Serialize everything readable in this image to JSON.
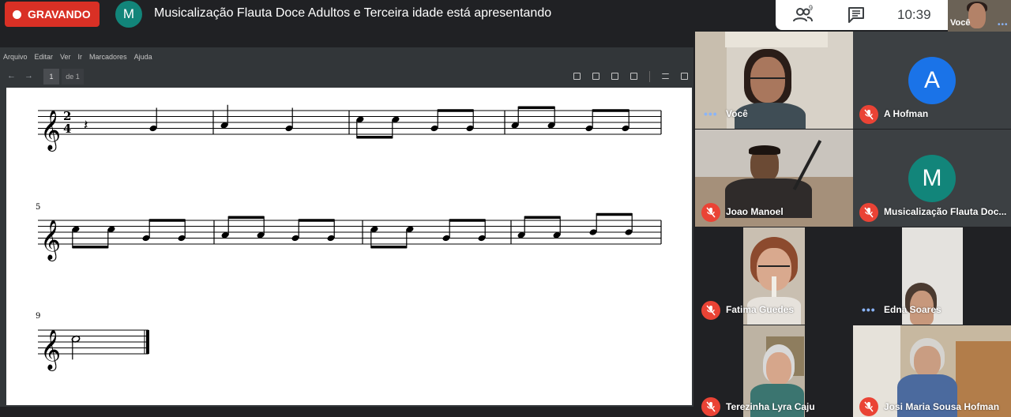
{
  "recording": {
    "label": "GRAVANDO"
  },
  "presenter": {
    "initial": "M",
    "title": "Musicalização Flauta Doce Adultos e Terceira idade está apresentando"
  },
  "controls": {
    "people_count": "9",
    "time": "10:39",
    "people_icon": "people-icon",
    "chat_icon": "chat-icon"
  },
  "self_view": {
    "label": "Você"
  },
  "viewer": {
    "menu": [
      "Arquivo",
      "Editar",
      "Ver",
      "Ir",
      "Marcadores",
      "Ajuda"
    ],
    "page_current": "1",
    "page_total": "de 1"
  },
  "score": {
    "time_signature": [
      "2",
      "4"
    ],
    "measure_numbers": [
      "5",
      "9"
    ]
  },
  "participants": [
    {
      "name": "Você",
      "mic": "active",
      "avatar": null
    },
    {
      "name": "A Hofman",
      "mic": "muted",
      "avatar": "A",
      "avatar_color": "#1a73e8"
    },
    {
      "name": "Joao Manoel",
      "mic": "muted",
      "avatar": null
    },
    {
      "name": "Musicalização Flauta Doc...",
      "mic": "muted",
      "avatar": "M",
      "avatar_color": "#12857a"
    },
    {
      "name": "Fatima Guedes",
      "mic": "muted",
      "avatar": null
    },
    {
      "name": "Edna Soares",
      "mic": "active",
      "avatar": null
    },
    {
      "name": "Terezinha Lyra Caju",
      "mic": "muted",
      "avatar": null
    },
    {
      "name": "Josi Maria Sousa Hofman",
      "mic": "muted",
      "avatar": null
    }
  ],
  "colors": {
    "background": "#202124",
    "recording": "#d93025",
    "mic_off": "#ea4335",
    "active_dots": "#8ab4f8"
  }
}
